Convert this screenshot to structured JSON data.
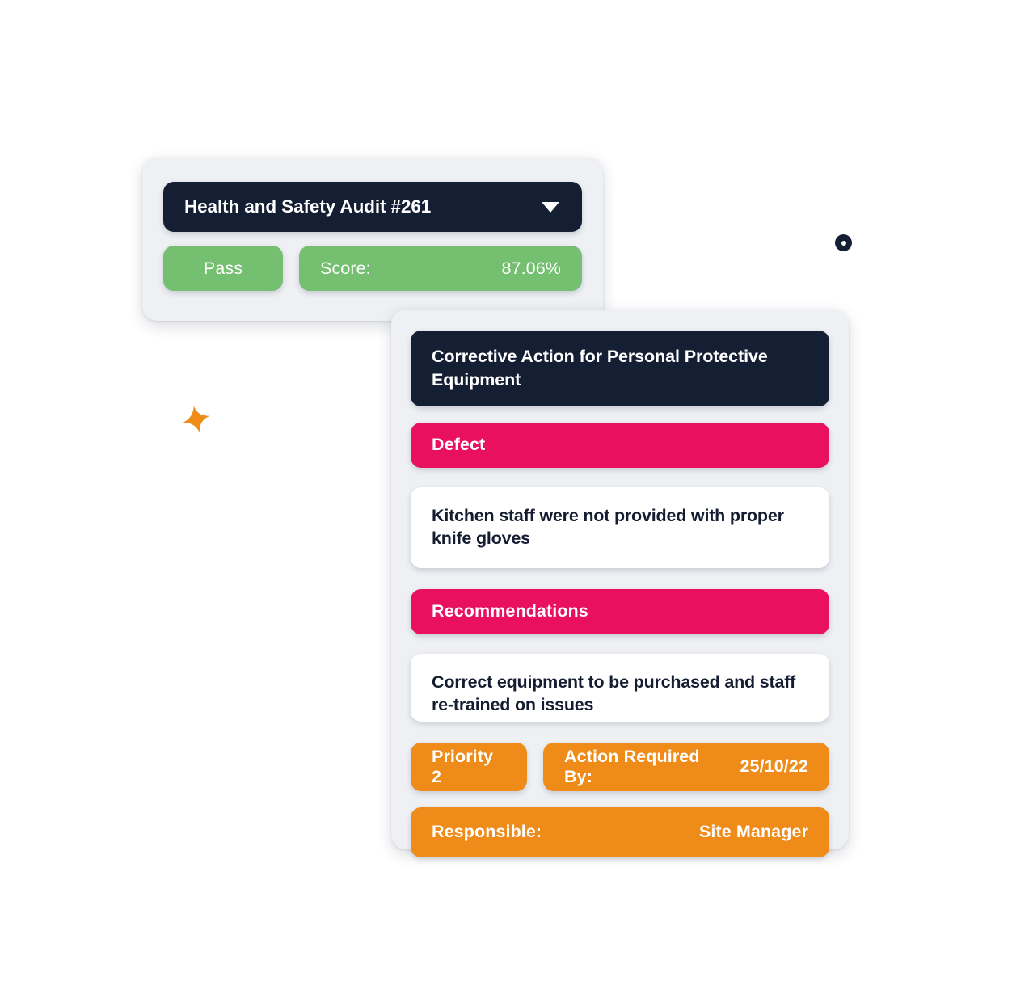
{
  "audit_card": {
    "title": "Health and Safety Audit #261",
    "dropdown_icon": "chevron-down-icon",
    "result_label": "Pass",
    "score_label": "Score:",
    "score_value": "87.06%"
  },
  "action_card": {
    "title": "Corrective Action for Personal Protective Equipment",
    "defect_label": "Defect",
    "defect_text": "Kitchen staff were not provided with proper knife gloves",
    "recommendations_label": "Recommendations",
    "recommendations_text": "Correct equipment to be purchased and staff re-trained on issues",
    "priority_label": "Priority 2",
    "action_required_label": "Action Required By:",
    "action_required_date": "25/10/22",
    "responsible_label": "Responsible:",
    "responsible_value": "Site Manager"
  },
  "decorations": {
    "ring_dot": "ring-dot-icon",
    "sparkle": "four-point-star-icon"
  },
  "colors": {
    "card_background": "#eef0f4",
    "dark": "#151f33",
    "green": "#74bf70",
    "pink": "#e8105f",
    "orange": "#ef8b18",
    "white": "#ffffff",
    "page_background": "#ffffff"
  }
}
